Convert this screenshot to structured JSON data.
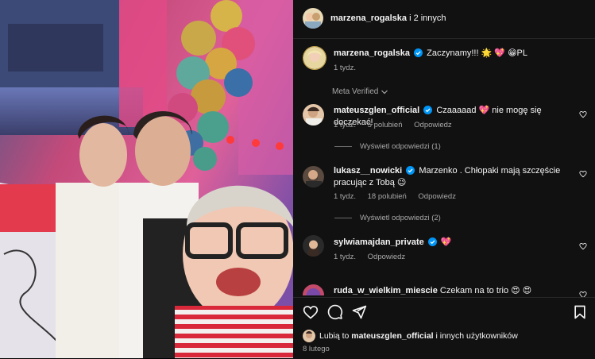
{
  "header": {
    "username": "marzena_rogalska",
    "others": "i 2 innych"
  },
  "caption": {
    "username": "marzena_rogalska",
    "text": "Zaczynamy!!! 🌟 💖 😁PL",
    "time": "1 tydz."
  },
  "meta_verified": "Meta Verified",
  "comments": [
    {
      "username": "mateuszglen_official",
      "verified": true,
      "text": "Czaaaaad 💖 nie mogę się doczekać!",
      "time": "1 tydz.",
      "likes": "5 polubień",
      "reply": "Odpowiedz",
      "view_replies": "Wyświetl odpowiedzi (1)"
    },
    {
      "username": "lukasz__nowicki",
      "verified": true,
      "text": "Marzenko . Chłopaki mają szczęście pracując z Tobą 😉",
      "time": "1 tydz.",
      "likes": "18 polubień",
      "reply": "Odpowiedz",
      "view_replies": "Wyświetl odpowiedzi (2)"
    },
    {
      "username": "sylwiamajdan_private",
      "verified": true,
      "text": "💖",
      "time": "1 tydz.",
      "reply": "Odpowiedz"
    },
    {
      "username": "ruda_w_wielkim_miescie",
      "verified": false,
      "text": "Czekam na to trio 😍 😍"
    }
  ],
  "likes_summary": {
    "prefix": "Lubią to",
    "username": "mateuszglen_official",
    "suffix": "i innych użytkowników"
  },
  "date": "8 lutego",
  "icons": {
    "like": "heart-icon",
    "comment": "comment-icon",
    "share": "share-icon",
    "save": "bookmark-icon",
    "more": "chevron-down-icon",
    "verified": "verified-badge-icon"
  },
  "colors": {
    "panel_bg": "#111111",
    "text_primary": "#f5f5f5",
    "text_secondary": "#a8a8a8",
    "verified_blue": "#0095f6"
  }
}
